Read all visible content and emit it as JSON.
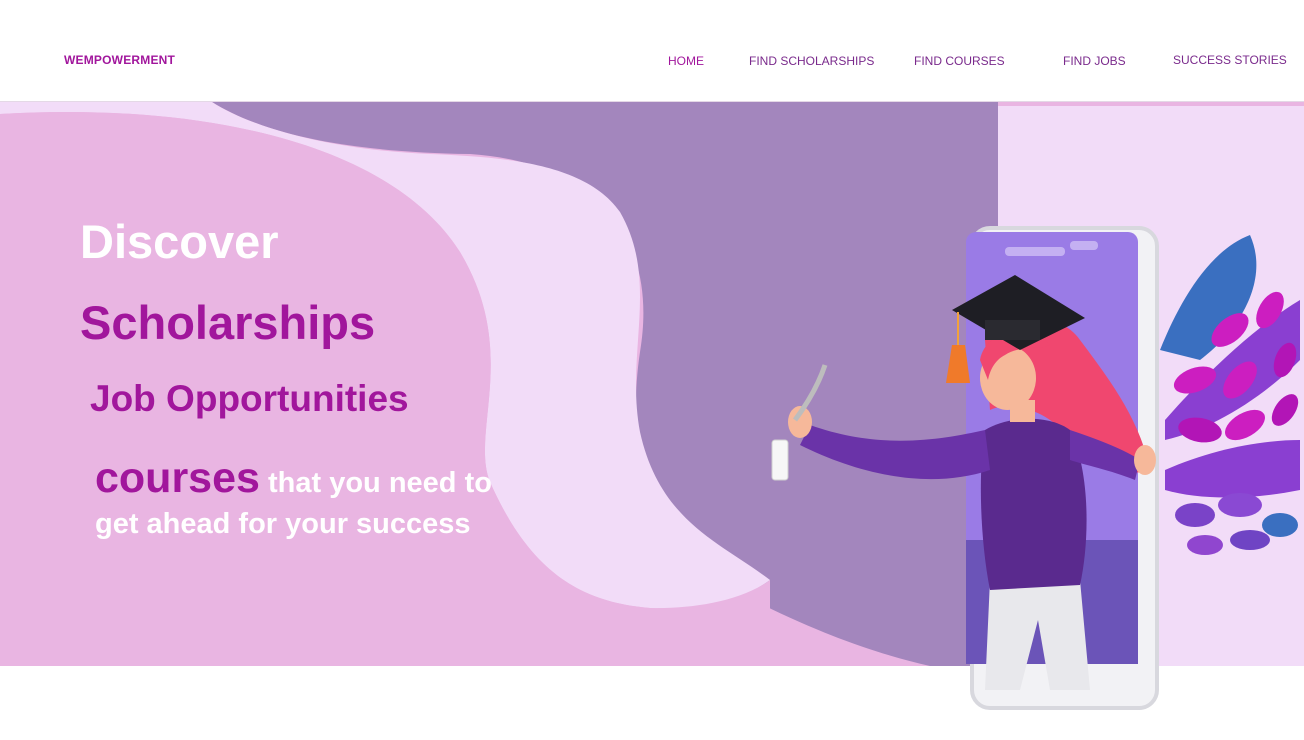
{
  "nav": {
    "brand": "WEMPOWERMENT",
    "links": [
      "HOME",
      "FIND SCHOLARSHIPS",
      "FIND COURSES",
      "FIND JOBS",
      "SUCCESS STORIES"
    ]
  },
  "hero": {
    "line1": "Discover",
    "line2": "Scholarships",
    "line3": "Job Opportunities",
    "line4_emphasis": "courses",
    "line4_rest": "that you need to get ahead for your success"
  },
  "colors": {
    "brand": "#a1169c",
    "nav_text": "#7a2a8c",
    "pink_panel": "#e9b5e2",
    "lavender": "#f2dcf8",
    "purple_blob": "#a386bd"
  },
  "icons": [
    "graduate-woman-illustration",
    "leaf-plant-illustration",
    "smartphone-illustration",
    "diploma-icon",
    "graduation-cap-icon"
  ]
}
